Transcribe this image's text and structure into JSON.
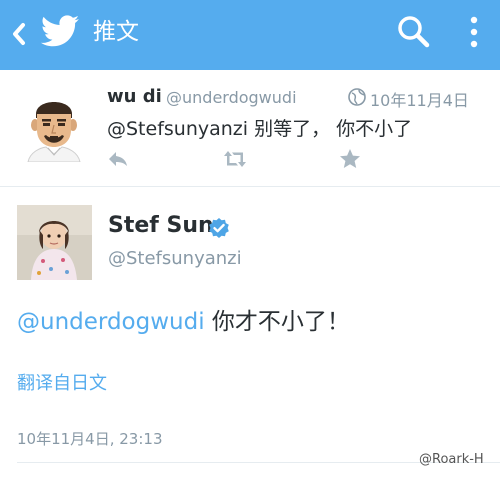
{
  "appbar": {
    "title": "推文",
    "background": "#55acee",
    "icons": [
      "back-icon",
      "twitter-bird-icon",
      "search-icon",
      "overflow-menu-icon"
    ]
  },
  "reply_tweet": {
    "name": "wu di",
    "handle": "@underdogwudi",
    "date": "10年11月4日",
    "text": "@Stefsunyanzi 别等了， 你不小了",
    "actions": [
      "reply-icon",
      "retweet-icon",
      "favorite-star-icon"
    ]
  },
  "main_tweet": {
    "name": "Stef Sun",
    "verified": true,
    "handle": "@Stefsunyanzi",
    "mention": "@underdogwudi",
    "text": " 你才不小了！",
    "translate_label": "翻译自日文",
    "timestamp": "10年11月4日, 23:13"
  },
  "watermark": "@Roark-H",
  "colors": {
    "accent": "#55acee",
    "secondary_text": "#8899a6",
    "primary_text": "#292f33"
  }
}
